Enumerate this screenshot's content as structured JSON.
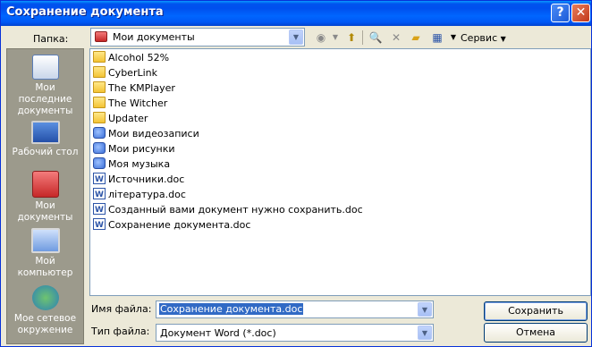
{
  "window": {
    "title": "Сохранение документа"
  },
  "folder_label": "Папка:",
  "folder_value": "Мои документы",
  "toolbar": {
    "service_label": "Сервис"
  },
  "places": [
    {
      "label": "Мои последние документы",
      "icon": "recent-documents-icon"
    },
    {
      "label": "Рабочий стол",
      "icon": "desktop-icon"
    },
    {
      "label": "Мои документы",
      "icon": "my-documents-icon"
    },
    {
      "label": "Мой компьютер",
      "icon": "my-computer-icon"
    },
    {
      "label": "Мое сетевое окружение",
      "icon": "network-icon"
    }
  ],
  "files": [
    {
      "name": "Alcohol 52%",
      "type": "folder"
    },
    {
      "name": "CyberLink",
      "type": "folder"
    },
    {
      "name": "The KMPlayer",
      "type": "folder"
    },
    {
      "name": "The Witcher",
      "type": "folder"
    },
    {
      "name": "Updater",
      "type": "folder"
    },
    {
      "name": "Мои видеозаписи",
      "type": "sysfolder"
    },
    {
      "name": "Мои рисунки",
      "type": "sysfolder"
    },
    {
      "name": "Моя музыка",
      "type": "sysfolder"
    },
    {
      "name": "Источники.doc",
      "type": "doc"
    },
    {
      "name": "література.doc",
      "type": "doc"
    },
    {
      "name": "Созданный вами документ нужно сохранить.doc",
      "type": "doc"
    },
    {
      "name": "Сохранение документа.doc",
      "type": "doc"
    }
  ],
  "filename_label": "Имя файла:",
  "filename_value": "Сохранение документа.doc",
  "filetype_label": "Тип файла:",
  "filetype_value": "Документ Word (*.doc)",
  "buttons": {
    "save": "Сохранить",
    "cancel": "Отмена"
  }
}
